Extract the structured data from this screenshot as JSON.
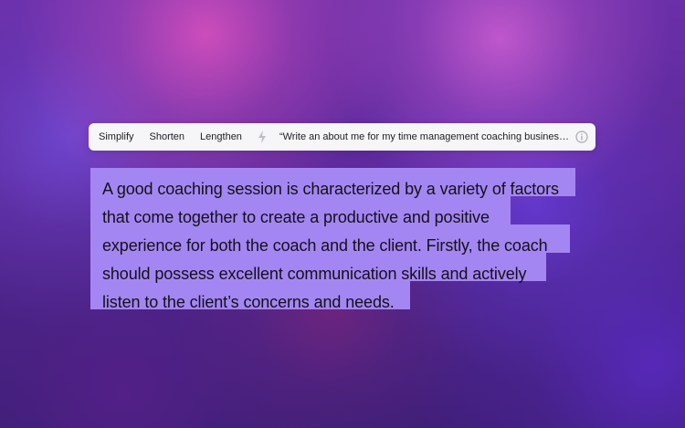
{
  "toolbar": {
    "actions": [
      {
        "label": "Simplify"
      },
      {
        "label": "Shorten"
      },
      {
        "label": "Lengthen"
      }
    ],
    "prompt_text": "“Write an about me for my time management coaching business in NYC”",
    "lightning_icon": "lightning-icon",
    "info_icon": "info-icon"
  },
  "content": {
    "lines": [
      "A good coaching session is characterized by a variety of factors",
      "that come together to create a productive and positive",
      "experience for both the coach and the client. Firstly, the coach",
      "should possess excellent communication skills and actively",
      "listen to the client’s concerns and needs."
    ]
  },
  "colors": {
    "toolbar_background": "#f6f6f8",
    "highlight": "#a486f3",
    "text": "#141019"
  }
}
